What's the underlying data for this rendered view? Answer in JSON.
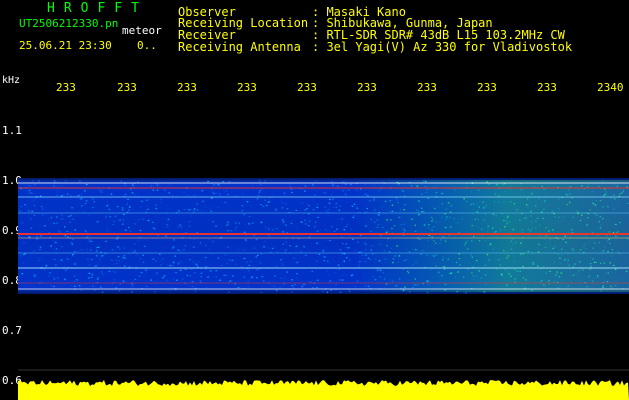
{
  "header": {
    "title": "HROFFT",
    "filename": "UT2506212330.pn",
    "tag": "meteor",
    "datetime": "25.06.21 23:30",
    "frac": "0..",
    "info": [
      {
        "label": "Observer",
        "value": ": Masaki Kano"
      },
      {
        "label": "Receiving Location",
        "value": ": Shibukawa, Gunma, Japan"
      },
      {
        "label": "Receiver",
        "value": ": RTL-SDR SDR# 43dB L15 103.2MHz CW"
      },
      {
        "label": "Receiving Antenna",
        "value": ": 3el Yagi(V) Az 330 for Vladivostok"
      }
    ]
  },
  "axis": {
    "unit": "kHz",
    "x_ticks": [
      "233",
      "233",
      "233",
      "233",
      "233",
      "233",
      "233",
      "233",
      "233",
      "2340"
    ],
    "y_ticks": [
      "1.1",
      "1.0",
      "0.9",
      "0.8",
      "0.7",
      "0.6"
    ]
  },
  "colors": {
    "text_green": "#00ff00",
    "text_yellow": "#ffff00",
    "text_white": "#ffffff",
    "noise_blue": "#0033cc",
    "noise_cyan": "#00ccff",
    "line_red": "#ff3322",
    "signal_yellow": "#ffff00",
    "background": "#000000"
  }
}
